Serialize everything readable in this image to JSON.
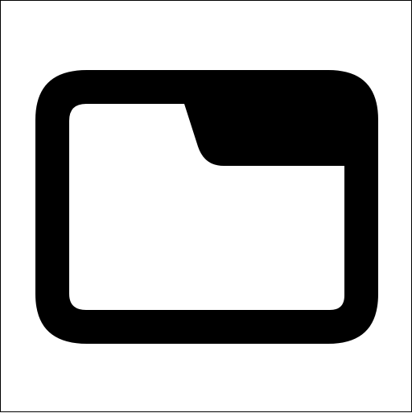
{
  "icon": {
    "name": "folder-icon",
    "glyph": "folder",
    "color": "#000000",
    "background": "#ffffff"
  }
}
